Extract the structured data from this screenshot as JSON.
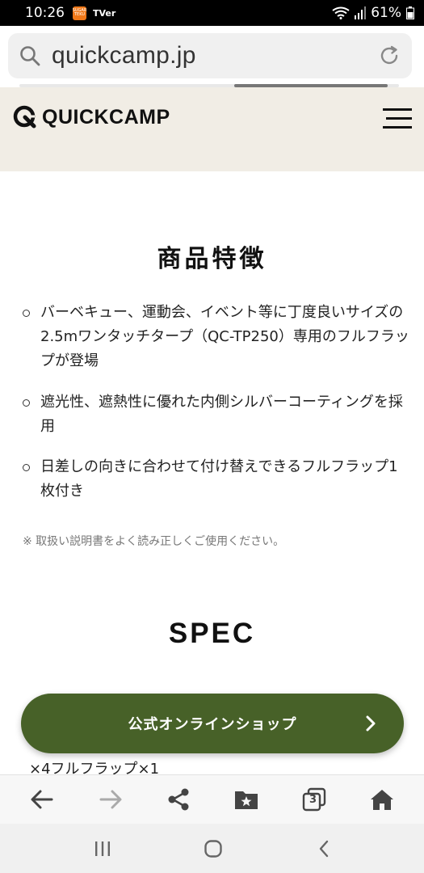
{
  "status_bar": {
    "time": "10:26",
    "app_badge_text": "SUGAR TEKU",
    "tv_label": "TVer",
    "battery": "61%"
  },
  "browser": {
    "url": "quickcamp.jp",
    "tab_count": "3"
  },
  "site": {
    "logo_text": "QUICKCAMP"
  },
  "features": {
    "title": "商品特徴",
    "items": [
      "バーベキュー、運動会、イベント等に丁度良いサイズの2.5mワンタッチタープ（QC-TP250）専用のフルフラップが登場",
      "遮光性、遮熱性に優れた内側シルバーコーティングを採用",
      "日差しの向きに合わせて付け替えできるフルフラップ1枚付き"
    ],
    "note": "※ 取扱い説明書をよく読み正しくご使用ください。"
  },
  "spec": {
    "title": "SPEC",
    "partial_text": "×4フルフラップ×1"
  },
  "shop_button": {
    "label": "公式オンラインショップ"
  },
  "colors": {
    "accent_green": "#476128",
    "header_beige": "#f1ede5"
  }
}
